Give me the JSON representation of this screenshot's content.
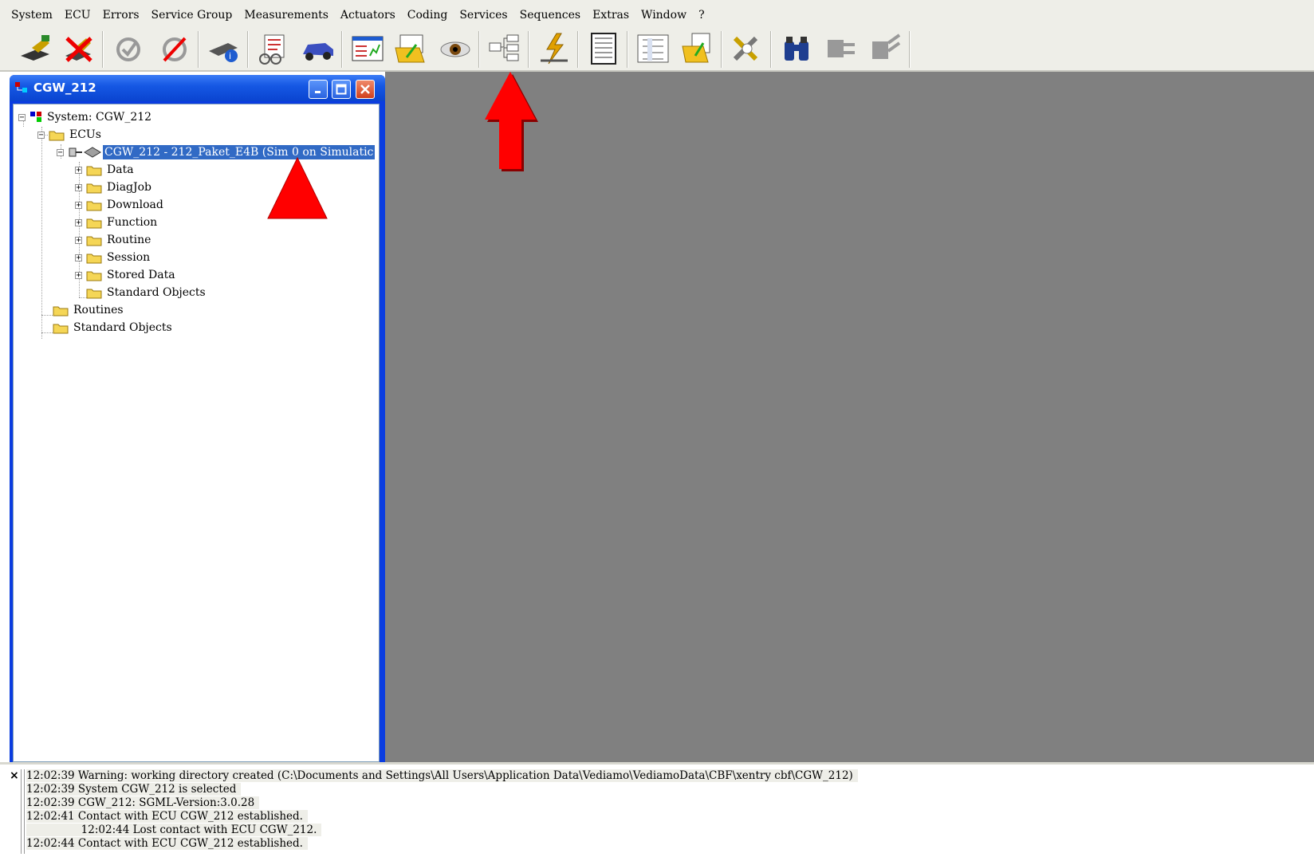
{
  "menu": {
    "items": [
      "System",
      "ECU",
      "Errors",
      "Service Group",
      "Measurements",
      "Actuators",
      "Coding",
      "Services",
      "Sequences",
      "Extras",
      "Window",
      "?"
    ]
  },
  "toolbar": {
    "buttons": [
      "connect-icon",
      "disconnect-icon",
      "refresh-icon",
      "reset-icon",
      "ecu-info-icon",
      "documents-icon",
      "vehicle-icon",
      "report-icon",
      "open-folder-icon",
      "view-icon",
      "tree-structure-icon",
      "flash-icon",
      "document-icon",
      "list-icon",
      "load-folder-icon",
      "tools-icon",
      "binoculars-icon",
      "plug-in-icon",
      "plug-out-icon"
    ]
  },
  "window": {
    "title": "CGW_212",
    "minimize": "minimize-icon",
    "maximize": "maximize-icon",
    "close": "close-icon"
  },
  "tree": {
    "system": "System: CGW_212",
    "ecus": "ECUs",
    "ecu_node": "CGW_212 - 212_Paket_E4B (Sim 0 on Simulatic",
    "ecu_children": [
      "Data",
      "DiagJob",
      "Download",
      "Function",
      "Routine",
      "Session",
      "Stored Data",
      "Standard Objects"
    ],
    "routines": "Routines",
    "standard_objects": "Standard Objects"
  },
  "colors": {
    "annotation": "#ff0000",
    "selection": "#316ac5",
    "titlebar": "#1658e4",
    "mdi_background": "#808080"
  },
  "log": {
    "close": "×",
    "lines": [
      "12:02:39 Warning: working directory created (C:\\Documents and Settings\\All Users\\Application Data\\Vediamo\\VediamoData\\CBF\\xentry cbf\\CGW_212)",
      "12:02:39 System CGW_212 is selected",
      "12:02:39 CGW_212: SGML-Version:3.0.28",
      "12:02:41 Contact with ECU CGW_212 established.",
      "                12:02:44 Lost contact with ECU CGW_212.",
      "12:02:44 Contact with ECU CGW_212 established."
    ]
  }
}
